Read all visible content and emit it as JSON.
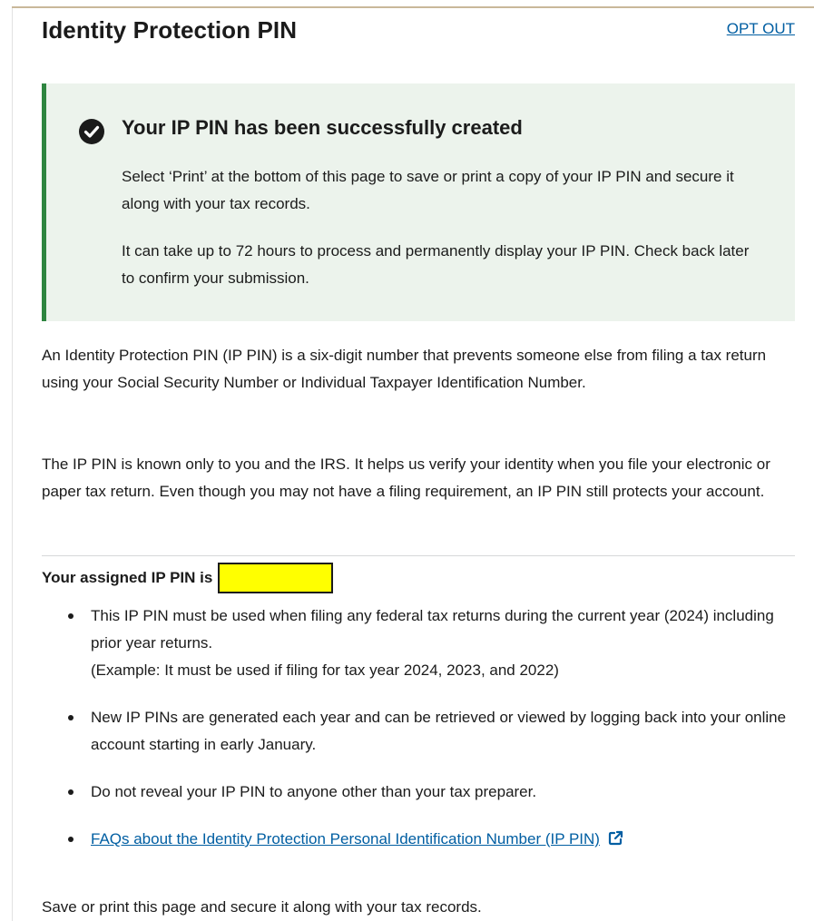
{
  "header": {
    "title": "Identity Protection PIN",
    "opt_out_label": "OPT OUT"
  },
  "alert": {
    "icon": "check-circle-icon",
    "heading": "Your IP PIN has been successfully created",
    "paragraph_1": "Select ‘Print’ at the bottom of this page to save or print a copy of your IP PIN and secure it along with your tax records.",
    "paragraph_2": "It can take up to 72 hours to process and permanently display your IP PIN. Check back later to confirm your submission.",
    "colors": {
      "background": "#ecf3ec",
      "border": "#2e8540"
    }
  },
  "intro": {
    "paragraph_1": "An Identity Protection PIN (IP PIN) is a six-digit number that prevents someone else from filing a tax return using your Social Security Number or Individual Taxpayer Identification Number.",
    "paragraph_2": "The IP PIN is known only to you and the IRS. It helps us verify your identity when you file your electronic or paper tax return. Even though you may not have a filing requirement, an IP PIN still protects your account."
  },
  "pin": {
    "label": "Your assigned IP PIN is",
    "redaction_color": "#ffff00"
  },
  "bullets": {
    "item_1_line_1": "This IP PIN must be used when filing any federal tax returns during the current year (2024) including prior year returns.",
    "item_1_line_2": "(Example: It must be used if filing for tax year 2024, 2023, and 2022)",
    "item_2": "New IP PINs are generated each year and can be retrieved or viewed by logging back into your online account starting in early January.",
    "item_3": "Do not reveal your IP PIN to anyone other than your tax preparer.",
    "item_4_link": "FAQs about the Identity Protection Personal Identification Number (IP PIN)",
    "item_4_icon": "external-link-icon"
  },
  "closing": "Save or print this page and secure it along with your tax records.",
  "colors": {
    "link": "#005ea2",
    "text": "#1b1b1b"
  }
}
